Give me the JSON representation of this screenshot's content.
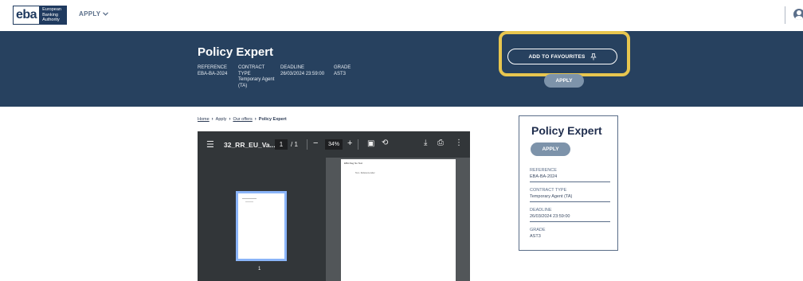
{
  "header": {
    "logo": {
      "mark": "eba",
      "lines": [
        "European",
        "Banking",
        "Authority"
      ]
    },
    "nav_apply": "APPLY",
    "chevron": "chevron-down-icon",
    "user_icon": "user-circle-icon"
  },
  "hero": {
    "title": "Policy Expert",
    "meta": [
      {
        "key": "REFERENCE",
        "value": "EBA-BA-2024"
      },
      {
        "key": "CONTRACT TYPE",
        "value": "Temporary Agent (TA)"
      },
      {
        "key": "DEADLINE",
        "value": "26/03/2024 23:59:00"
      },
      {
        "key": "GRADE",
        "value": "AST3"
      }
    ],
    "favourites_label": "ADD TO FAVOURITES",
    "favourites_icon": "pin-icon",
    "apply_label": "APPLY",
    "highlight_color": "#e8c64f"
  },
  "breadcrumb": {
    "home": "Home",
    "apply": "Apply",
    "offers": "Our offers",
    "current": "Policy Expert",
    "separator": "›"
  },
  "pdf_viewer": {
    "filename": "32_RR_EU_Va...",
    "page_current": "1",
    "page_total": "/ 1",
    "zoom": "34%",
    "thumb_label": "1",
    "page_heading": "EBA Reg No Text",
    "page_text": "Text - Reference letter"
  },
  "card": {
    "title": "Policy Expert",
    "apply_label": "APPLY",
    "items": [
      {
        "key": "REFERENCE",
        "value": "EBA-BA-2024"
      },
      {
        "key": "CONTRACT TYPE",
        "value": "Temporary Agent (TA)"
      },
      {
        "key": "DEADLINE",
        "value": "26/03/2024 23:59:00"
      },
      {
        "key": "GRADE",
        "value": "AST3"
      }
    ]
  },
  "colors": {
    "hero_bg": "#27415f",
    "button_bg": "#7d93aa",
    "viewer_bg": "#525659",
    "viewer_toolbar": "#323639"
  }
}
